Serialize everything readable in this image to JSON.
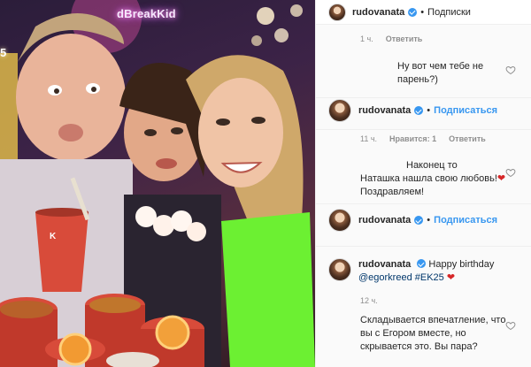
{
  "photo": {
    "neon_sign": "dBreakKid",
    "neon_number": "5",
    "cup_brand": "K"
  },
  "header": {
    "username": "rudovanata",
    "separator": "•",
    "follow_label": "Подписки"
  },
  "comments": [
    {
      "time": "1 ч.",
      "reply_label": "Ответить",
      "text": "Ну вот чем тебе не парень?)"
    },
    {
      "username": "rudovanata",
      "separator": "•",
      "follow_label": "Подписаться",
      "time": "11 ч.",
      "likes_label": "Нравится: 1",
      "reply_label": "Ответить",
      "text_line1": "Наконец то",
      "text_line2": "Наташка нашла свою любовь!",
      "text_heart": "❤",
      "text_line3": "Поздравляем!"
    },
    {
      "username": "rudovanata",
      "separator": "•",
      "follow_label": "Подписаться"
    },
    {
      "username": "rudovanata",
      "caption_prefix": "Happy birthday",
      "mention": "@egorkreed",
      "hashtag": "#EK25",
      "caption_heart": "❤",
      "time": "12 ч.",
      "text": "Складывается впечатление, что вы с Егором вместе, но скрывается это. Вы пара?"
    }
  ],
  "colors": {
    "accent_blue": "#3897f0",
    "link_dark": "#00376b",
    "heart_red": "#d62728"
  }
}
